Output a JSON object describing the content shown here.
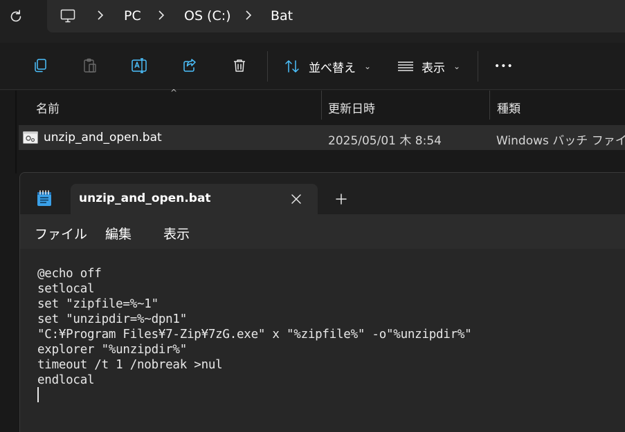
{
  "address": {
    "crumbs": [
      "PC",
      "OS (C:)",
      "Bat"
    ]
  },
  "toolbar": {
    "sort_label": "並べ替え",
    "view_label": "表示",
    "more_label": "•••"
  },
  "file_list": {
    "columns": [
      "名前",
      "更新日時",
      "種類"
    ],
    "rows": [
      {
        "name": "unzip_and_open.bat",
        "modified": "2025/05/01 木 8:54",
        "type": "Windows バッチ ファイル"
      }
    ]
  },
  "notepad": {
    "tab_title": "unzip_and_open.bat",
    "menu": [
      "ファイル",
      "編集",
      "表示"
    ],
    "lines": [
      "@echo off",
      "setlocal",
      "set \"zipfile=%~1\"",
      "set \"unzipdir=%~dpn1\"",
      "\"C:¥Program Files¥7-Zip¥7zG.exe\" x \"%zipfile%\" -o\"%unzipdir%\"",
      "explorer \"%unzipdir%\"",
      "timeout /t 1 /nobreak >nul",
      "endlocal"
    ]
  },
  "colors": {
    "accent": "#4cc2ff",
    "background": "#1c1c1c",
    "notepad_icon": "#3aa0e8"
  }
}
